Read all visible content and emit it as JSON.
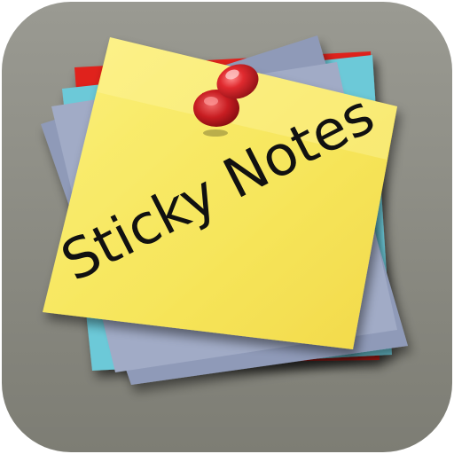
{
  "app": {
    "title": "Sticky Notes"
  },
  "colors": {
    "icon_bg": "#8a8a80",
    "note_yellow": "#f7e85c",
    "note_gray_blue": "#98a2c0",
    "note_cyan": "#6cc9d8",
    "note_red": "#e0221c",
    "pin_red": "#d8272c",
    "text": "#111111"
  },
  "icons": {
    "pin": "push-pin-icon"
  }
}
